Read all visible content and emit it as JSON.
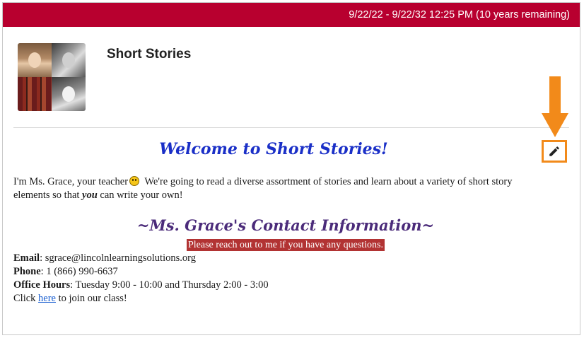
{
  "header": {
    "date_range": "9/22/22 - 9/22/32 12:25 PM (10 years remaining)"
  },
  "course": {
    "title": "Short Stories",
    "thumbnail_icon": "course-collage-image"
  },
  "colors": {
    "banner": "#b8002f",
    "welcome_text": "#1a2fc7",
    "contact_heading": "#4b2b7a",
    "notice_bg": "#b23333",
    "highlight_arrow": "#f28a1a"
  },
  "content": {
    "welcome": "Welcome to Short Stories!",
    "intro_part1": "I'm Ms. Grace, your teacher",
    "intro_part2": " We're going to read a diverse assortment of stories and learn about a variety of short story elements so that ",
    "intro_emphasis": "you",
    "intro_part3": " can write your own!",
    "contact_heading": "~Ms. Grace's Contact Information~",
    "notice": "Please reach out to me if you have any questions.",
    "email_label": "Email",
    "email_value": ": sgrace@lincolnlearningsolutions.org",
    "phone_label": "Phone",
    "phone_value": ": 1 (866) 990-6637",
    "hours_label": "Office Hours",
    "hours_value": ": Tuesday 9:00 - 10:00 and Thursday 2:00 - 3:00",
    "click_prefix": "Click ",
    "link_text": "here",
    "click_suffix": " to join our class!"
  },
  "edit": {
    "icon": "pencil-icon"
  }
}
